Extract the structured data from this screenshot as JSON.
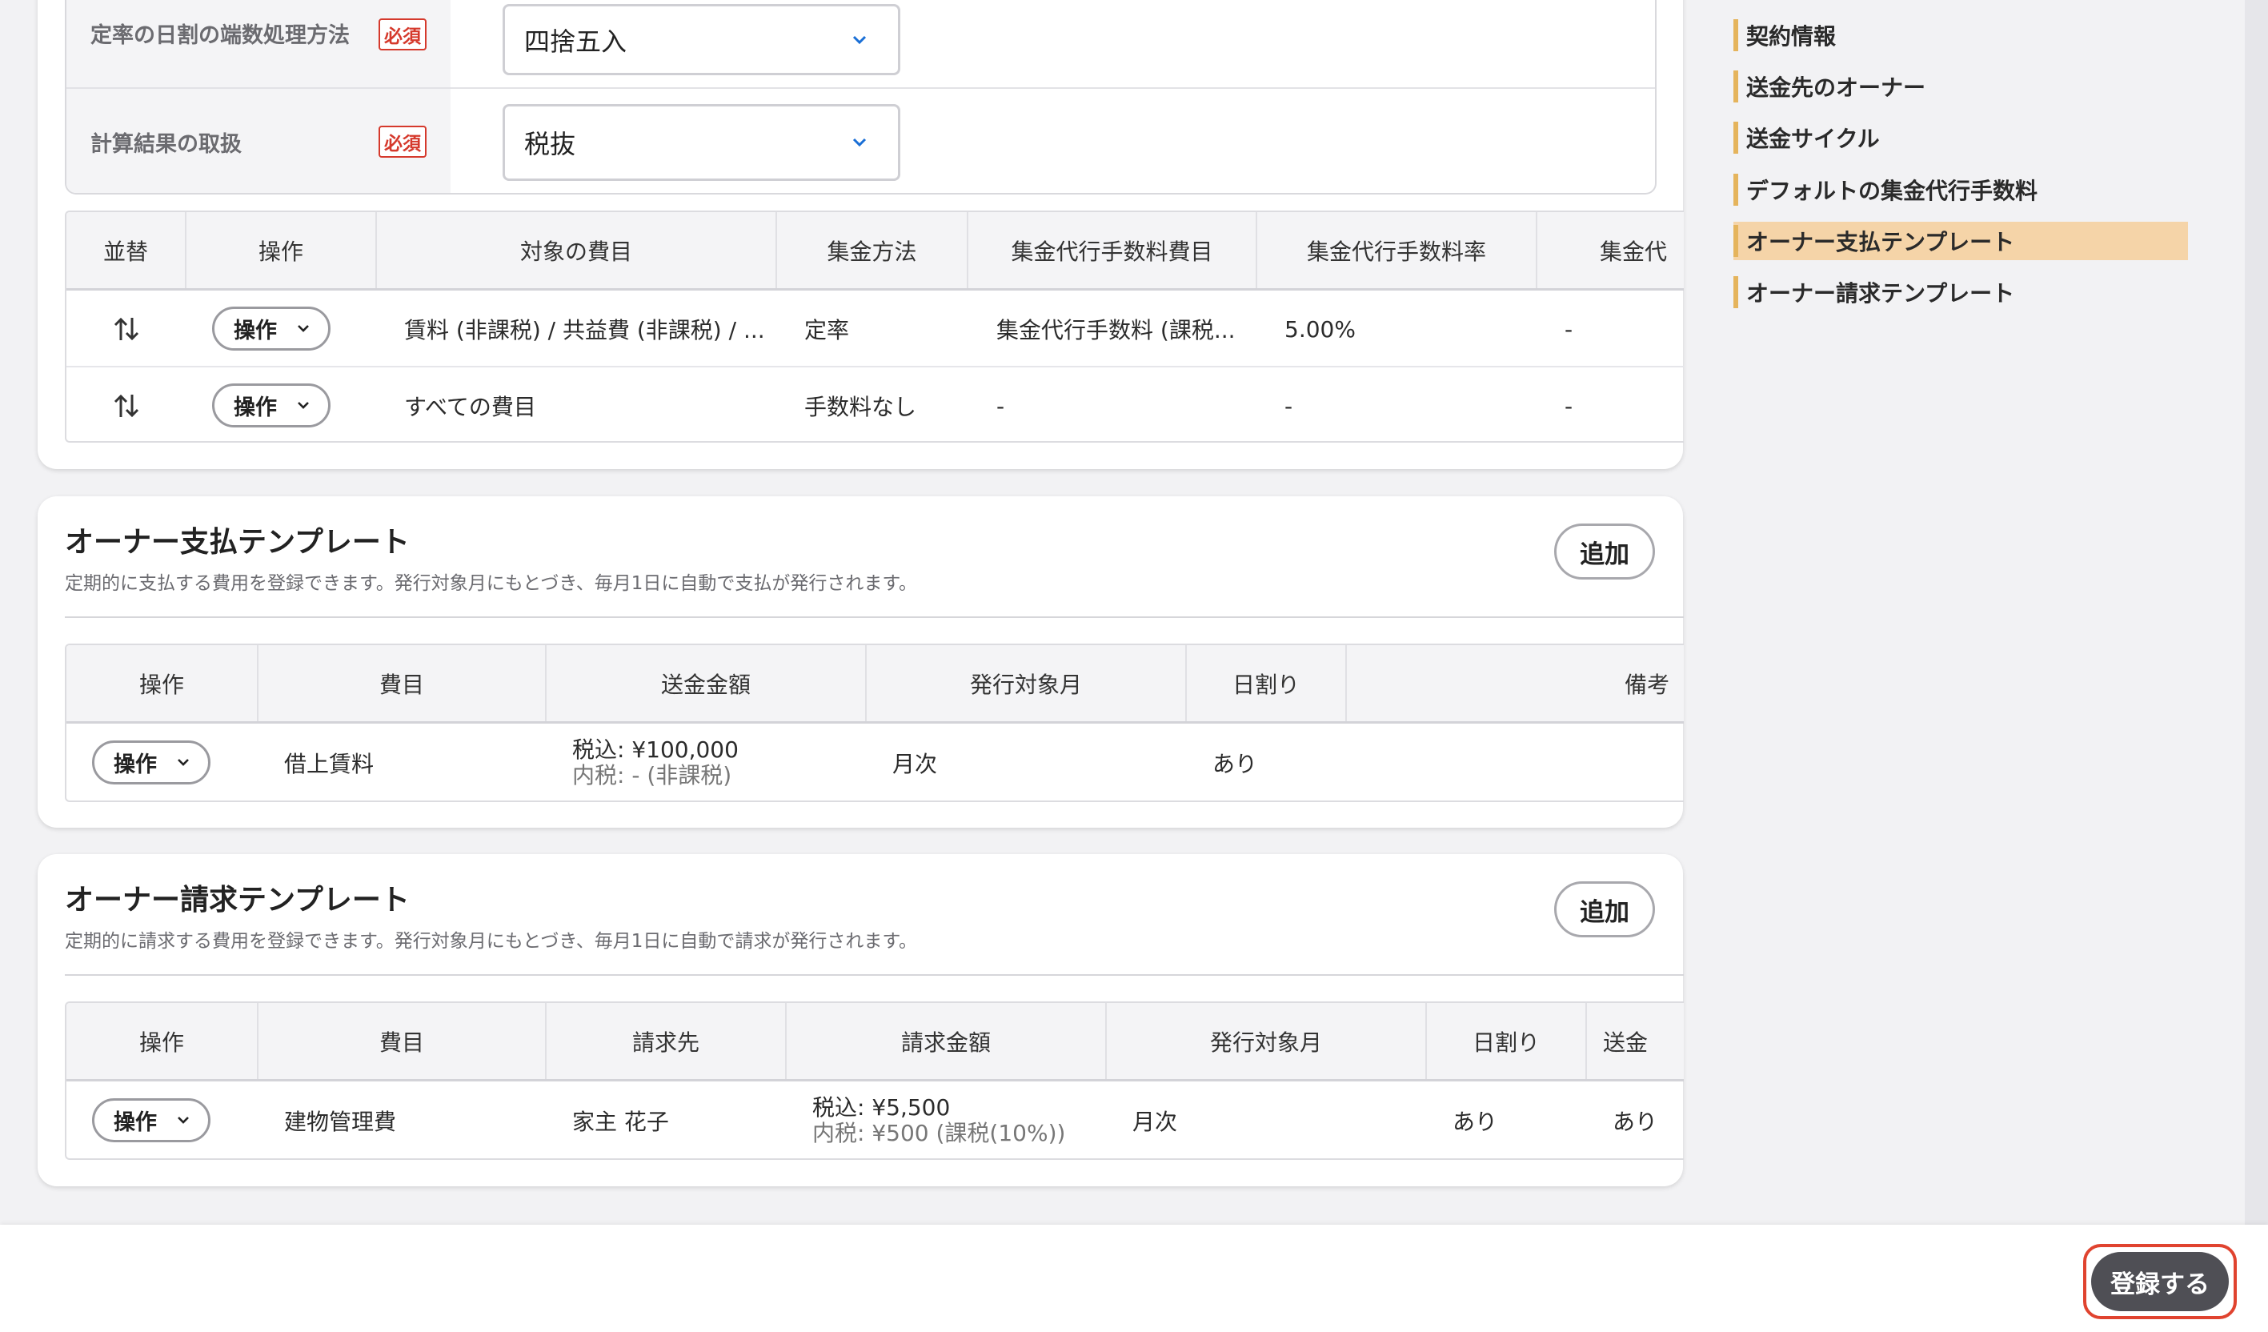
{
  "settings": {
    "rounding_label": "定率の日割の端数処理方法",
    "rounding_value": "四捨五入",
    "calc_label": "計算結果の取扱",
    "calc_value": "税抜",
    "required_badge": "必須"
  },
  "fee_table": {
    "headers": [
      "並替",
      "操作",
      "対象の費目",
      "集金方法",
      "集金代行手数料費目",
      "集金代行手数料率",
      "集金代"
    ],
    "rows": [
      {
        "op": "操作",
        "target": "賃料 (非課税) / 共益費 (非課税) / ...",
        "method": "定率",
        "fee_item": "集金代行手数料 (課税...",
        "rate": "5.00%",
        "extra": "-"
      },
      {
        "op": "操作",
        "target": "すべての費目",
        "method": "手数料なし",
        "fee_item": "-",
        "rate": "-",
        "extra": "-"
      }
    ]
  },
  "payment_template": {
    "title": "オーナー支払テンプレート",
    "description": "定期的に支払する費用を登録できます。発行対象月にもとづき、毎月1日に自動で支払が発行されます。",
    "add_label": "追加",
    "headers": [
      "操作",
      "費目",
      "送金金額",
      "発行対象月",
      "日割り",
      "備考"
    ],
    "rows": [
      {
        "op": "操作",
        "item": "借上賃料",
        "amount": "税込: ¥100,000",
        "amount_sub": "内税: - (非課税)",
        "month": "月次",
        "prorate": "あり",
        "note": ""
      }
    ]
  },
  "billing_template": {
    "title": "オーナー請求テンプレート",
    "description": "定期的に請求する費用を登録できます。発行対象月にもとづき、毎月1日に自動で請求が発行されます。",
    "add_label": "追加",
    "headers": [
      "操作",
      "費目",
      "請求先",
      "請求金額",
      "発行対象月",
      "日割り",
      "送金"
    ],
    "rows": [
      {
        "op": "操作",
        "item": "建物管理費",
        "payee": "家主 花子",
        "amount": "税込: ¥5,500",
        "amount_sub": "内税: ¥500 (課税(10%))",
        "month": "月次",
        "prorate": "あり",
        "remit": "あり"
      }
    ]
  },
  "nav": {
    "items": [
      "契約情報",
      "送金先のオーナー",
      "送金サイクル",
      "デフォルトの集金代行手数料",
      "オーナー支払テンプレート",
      "オーナー請求テンプレート"
    ],
    "active_index": 4
  },
  "footer": {
    "submit_label": "登録する"
  },
  "colors": {
    "accent": "#e5b45c",
    "active_nav_bg": "#f5d4a8",
    "required": "#d5392c",
    "submit_bg": "#4f4f55",
    "submit_focus": "#e0432f"
  }
}
